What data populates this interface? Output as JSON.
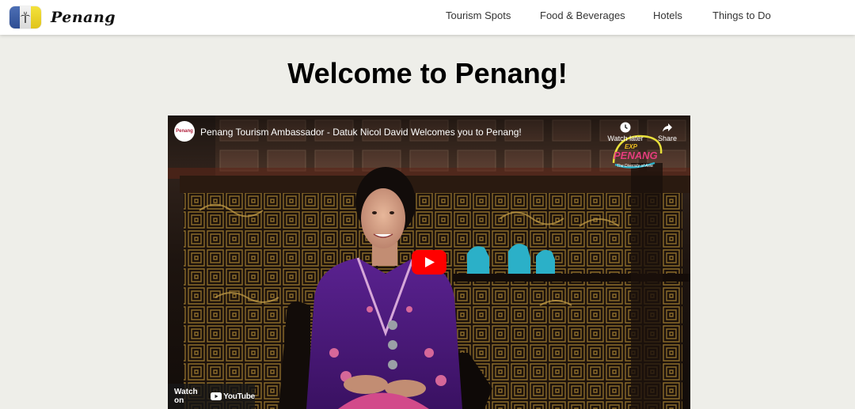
{
  "header": {
    "brand": "Penang",
    "nav": [
      {
        "label": "Tourism Spots"
      },
      {
        "label": "Food & Beverages"
      },
      {
        "label": "Hotels"
      },
      {
        "label": "Things to Do"
      }
    ]
  },
  "main": {
    "title": "Welcome to Penang!"
  },
  "video": {
    "title": "Penang Tourism Ambassador - Datuk Nicol David Welcomes you to Penang!",
    "channel_logo_text": "Penang",
    "watch_later": "Watch later",
    "share": "Share",
    "watch_on": "Watch on",
    "youtube": "YouTube",
    "badge_text": "Experience PENANG The Diversity of Asia",
    "icons": [
      "clock-icon",
      "share-arrow-icon",
      "play-icon",
      "youtube-logo-icon",
      "palm-tree-icon"
    ],
    "colors": {
      "play": "#ff0000",
      "dress": "#4b1a7a",
      "cabinet": "#2a1a10"
    }
  }
}
